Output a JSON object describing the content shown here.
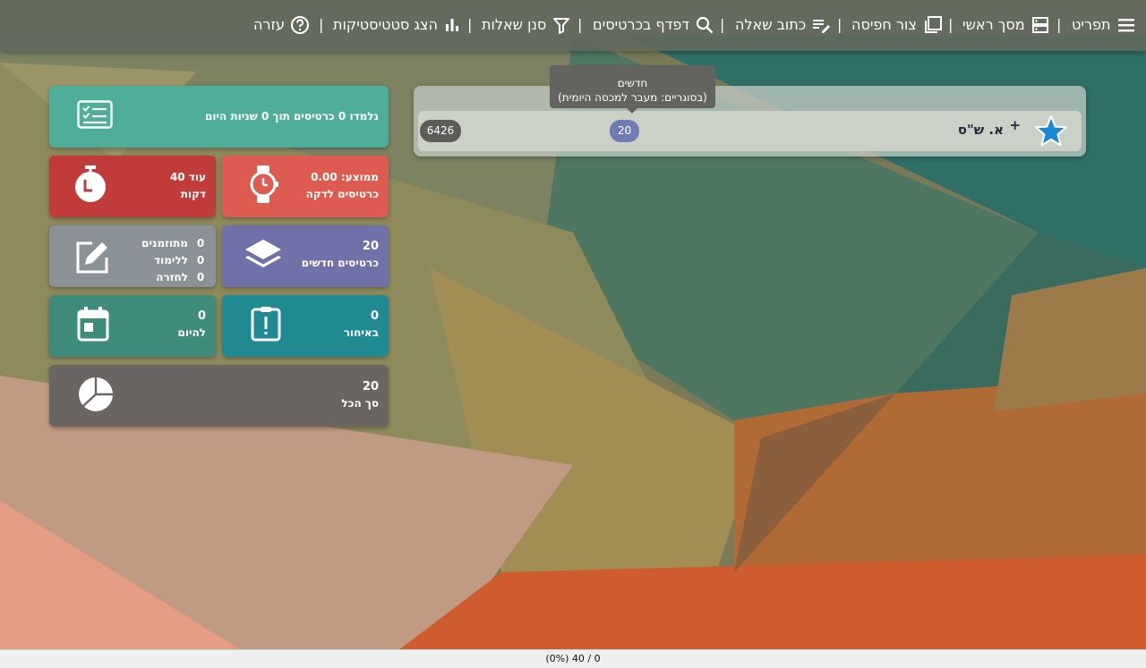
{
  "toolbar": {
    "menu_label": "תפריט",
    "main_screen_label": "מסך ראשי",
    "cram_label": "צור חפיסה",
    "write_question_label": "כתוב שאלה",
    "browse_label": "דפדף בכרטיסים",
    "filter_label": "סנן שאלות",
    "stats_label": "הצג סטטיסטיקות",
    "help_label": "עזרה",
    "separator": "|"
  },
  "deck": {
    "name": "א. ש\"ס",
    "plus": "+",
    "new_count": "20",
    "total_count": "6426",
    "tooltip_line1": "חדשים",
    "tooltip_line2": "(בסוגריים: מעבר למכסה היומית)"
  },
  "cards": {
    "learned_today": "נלמדו 0 כרטיסים תוך 0 שניות היום",
    "average_line1": "ממוצע: 0.00",
    "average_line2": "כרטיסים לדקה",
    "remaining_line1": "עוד 40",
    "remaining_line2": "דקות",
    "new_value": "20",
    "new_label": "כרטיסים חדשים",
    "suspended_value": "0",
    "suspended_label": "מתוזמנים",
    "learn_value": "0",
    "learn_label": "ללימוד",
    "review_value": "0",
    "review_label": "לחזרה",
    "overdue_value": "0",
    "overdue_label": "באיחור",
    "today_value": "0",
    "today_label": "להיום",
    "total_value": "20",
    "total_label": "סך הכל"
  },
  "status": {
    "progress_text": "(0%) 40 / 0"
  },
  "colors": {
    "toolbar": "#62685c",
    "teal": "#4fae9b",
    "red": "#c23b3b",
    "salmon": "#de5b52",
    "grey": "#8a9297",
    "purple": "#7071a9",
    "green": "#3f8b7c",
    "cyan": "#1f8a91",
    "dark": "#6a6462",
    "star": "#1e88d8"
  }
}
